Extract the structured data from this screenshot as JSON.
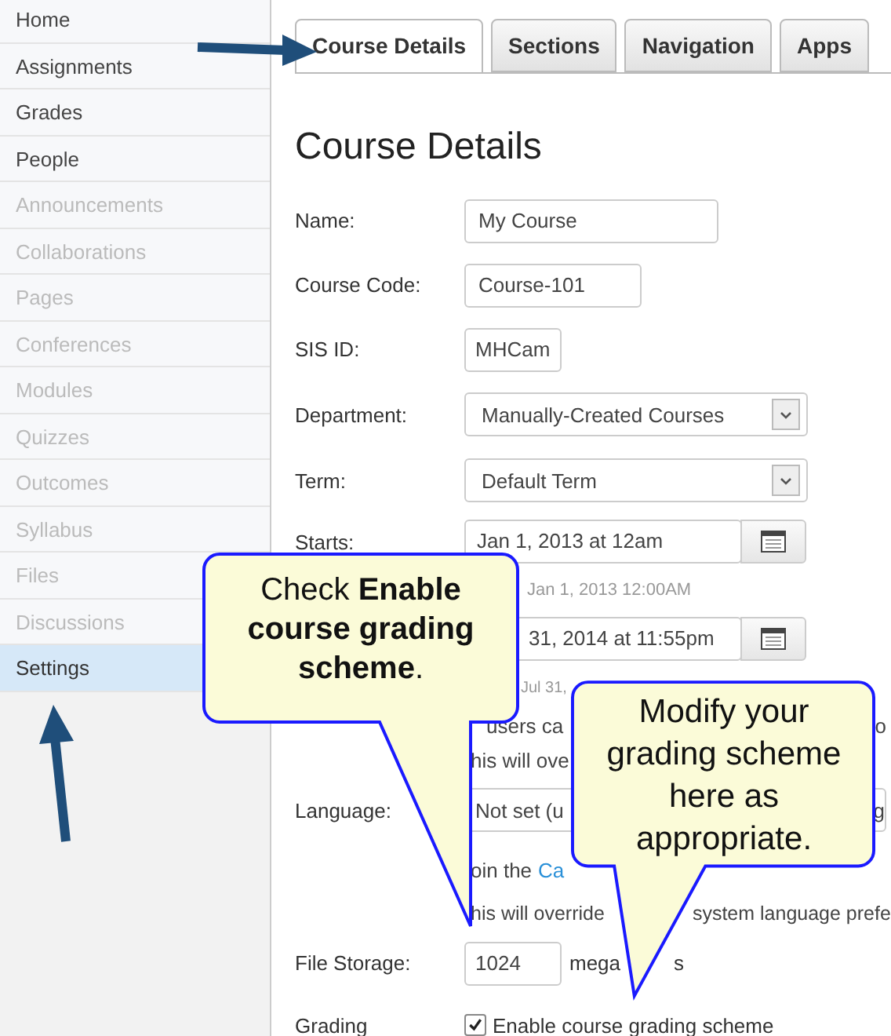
{
  "sidebar": {
    "items": [
      {
        "label": "Home",
        "disabled": false,
        "selected": false
      },
      {
        "label": "Assignments",
        "disabled": false,
        "selected": false
      },
      {
        "label": "Grades",
        "disabled": false,
        "selected": false
      },
      {
        "label": "People",
        "disabled": false,
        "selected": false
      },
      {
        "label": "Announcements",
        "disabled": true,
        "selected": false
      },
      {
        "label": "Collaborations",
        "disabled": true,
        "selected": false
      },
      {
        "label": "Pages",
        "disabled": true,
        "selected": false
      },
      {
        "label": "Conferences",
        "disabled": true,
        "selected": false
      },
      {
        "label": "Modules",
        "disabled": true,
        "selected": false
      },
      {
        "label": "Quizzes",
        "disabled": true,
        "selected": false
      },
      {
        "label": "Outcomes",
        "disabled": true,
        "selected": false
      },
      {
        "label": "Syllabus",
        "disabled": true,
        "selected": false
      },
      {
        "label": "Files",
        "disabled": true,
        "selected": false
      },
      {
        "label": "Discussions",
        "disabled": true,
        "selected": false
      },
      {
        "label": "Settings",
        "disabled": false,
        "selected": true
      }
    ]
  },
  "tabs": [
    {
      "label": "Course Details",
      "selected": true
    },
    {
      "label": "Sections",
      "selected": false
    },
    {
      "label": "Navigation",
      "selected": false
    },
    {
      "label": "Apps",
      "selected": false
    }
  ],
  "heading": "Course Details",
  "form": [
    {
      "kind": "text",
      "label": "Name:",
      "value": "My Course"
    },
    {
      "kind": "text",
      "label": "Course Code:",
      "value": "Course-101"
    },
    {
      "kind": "text",
      "label": "SIS ID:",
      "value": "MHCam"
    },
    {
      "kind": "select",
      "label": "Department:",
      "value": "Manually-Created Courses"
    },
    {
      "kind": "select",
      "label": "Term:",
      "value": "Default Term"
    },
    {
      "kind": "date",
      "label": "Starts:",
      "value": "Jan 1, 2013 at 12am"
    },
    {
      "kind": "hint",
      "left": "Jan 1, 2013 12:00AM"
    },
    {
      "kind": "date",
      "value": "31, 2014 at 11:55pm"
    },
    {
      "kind": "hint",
      "left": "Jul 31,"
    },
    {
      "kind": "note",
      "left": "users ca",
      "right": "o"
    },
    {
      "kind": "note",
      "left": "his will ove"
    },
    {
      "kind": "select",
      "label": "Language:",
      "value": "Not set (u",
      "right": "g"
    },
    {
      "kind": "note",
      "left": "oin the",
      "link": "Ca"
    },
    {
      "kind": "note",
      "left": "his will override",
      "right": "system language prefe"
    },
    {
      "kind": "storage",
      "label": "File Storage:",
      "value": "1024",
      "unit": "mega",
      "right": "s"
    },
    {
      "kind": "checkbox",
      "label": "Grading",
      "text": "Enable course grading scheme",
      "checked": true
    }
  ],
  "callouts": [
    {
      "text": "Check **Enable course grading scheme**."
    },
    {
      "text": "Modify your grading scheme here as appropriate."
    }
  ]
}
